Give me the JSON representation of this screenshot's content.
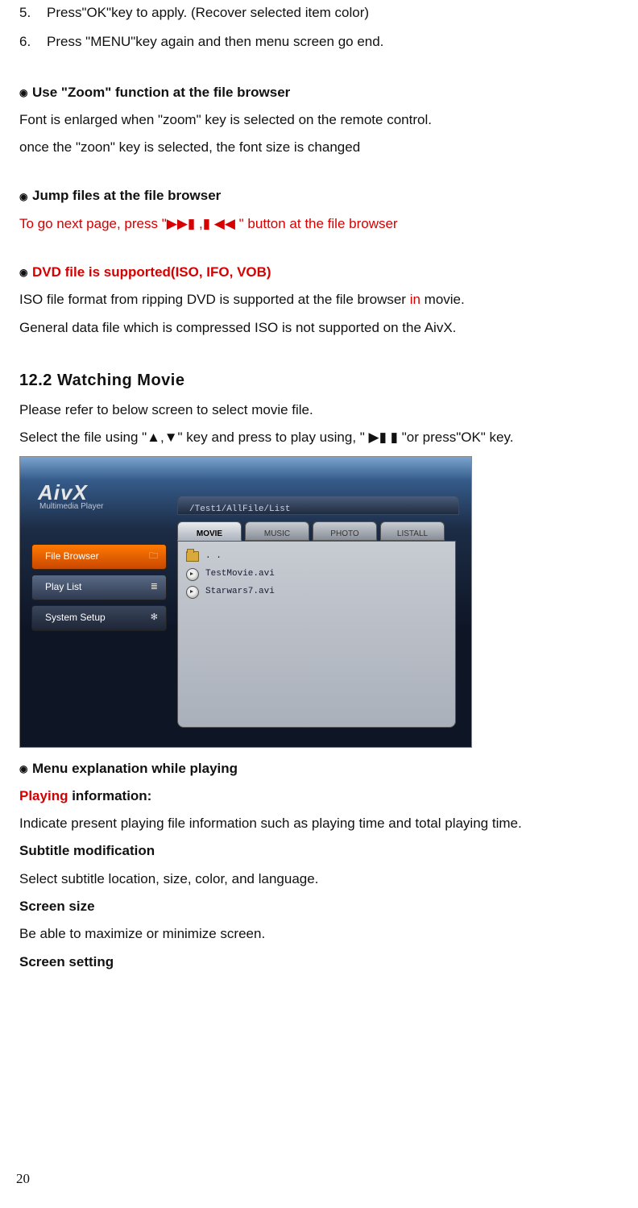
{
  "list5": {
    "num": "5.",
    "text": "Press\"OK\"key to apply. (Recover selected item color)"
  },
  "list6": {
    "num": "6.",
    "text": "Press \"MENU\"key again and then menu screen go end."
  },
  "zoom": {
    "bullet": "◉",
    "title": "Use \"Zoom\" function at the file browser",
    "line1": "Font is enlarged when \"zoom\" key is selected on the remote control.",
    "line2": "once the \"zoon\" key is selected, the font size is changed"
  },
  "jump": {
    "bullet": "◉",
    "title": "Jump files at the file browser",
    "line1a": "To go next page, press \"",
    "line1sym": "▶▶▮ ,▮ ◀◀",
    "line1b": " \" button at the file browser"
  },
  "dvd": {
    "bullet": "◉",
    "title": "DVD file is supported(ISO, IFO, VOB)",
    "line1a": "ISO file format from ripping DVD is supported at the file browser ",
    "line1red": "in",
    "line1b": " movie.",
    "line2": "General data file which is compressed ISO is not supported on the AivX."
  },
  "h2": "12.2  Watching Movie",
  "watch": {
    "line1": "Please refer to below screen to select movie file.",
    "line2": "Select the file using   \"▲,▼\" key and press to play using, \" ▶▮ ▮ \"or press\"OK\" key."
  },
  "mock": {
    "logo": "AivX",
    "logo_sub": "Multimedia Player",
    "side": {
      "file_browser": "File Browser",
      "play_list": "Play List",
      "system_setup": "System Setup"
    },
    "path": "/Test1/AllFile/List",
    "tabs": {
      "movie": "MOVIE",
      "music": "MUSIC",
      "photo": "PHOTO",
      "listall": "LISTALL"
    },
    "rows": {
      "up": ". .",
      "f1": "TestMovie.avi",
      "f2": "Starwars7.avi"
    }
  },
  "menu": {
    "bullet": "◉",
    "title": "Menu explanation while playing",
    "playing_label_red": "Playing",
    "playing_label_rest": " information:",
    "playing_desc": "Indicate present playing file information such as playing time and total playing time.",
    "subtitle_label": "Subtitle modification",
    "subtitle_desc": "Select subtitle location, size, color, and language.",
    "size_label": "Screen size",
    "size_desc": "Be able to maximize or minimize screen.",
    "setting_label": "Screen setting"
  },
  "page_number": "20"
}
